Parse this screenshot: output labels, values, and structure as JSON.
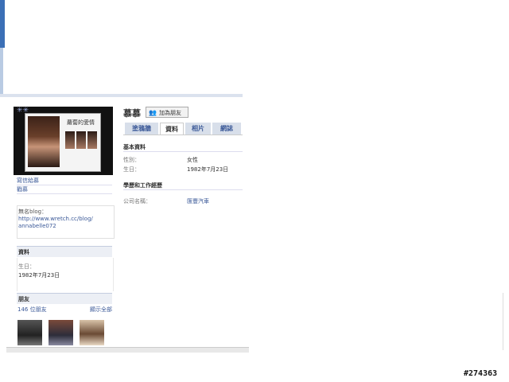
{
  "profile": {
    "name": "慕慕",
    "add_friend_label": "加為朋友",
    "photo_title": "蘿蔔的愛情",
    "links": [
      "寫信給慕",
      "戳慕"
    ],
    "blog": {
      "label": "無名blog：",
      "url_line1": "http://www.wretch.cc/blog/",
      "url_line2": "annabelle072"
    },
    "info_box": {
      "heading": "資料",
      "birthday_label": "生日：",
      "birthday_value": "1982年7月23日"
    },
    "friends": {
      "heading": "朋友",
      "count_label": "146 位朋友",
      "show_all_label": "顯示全部"
    }
  },
  "tabs": [
    {
      "label": "塗鴉牆",
      "active": false
    },
    {
      "label": "資料",
      "active": true
    },
    {
      "label": "相片",
      "active": false
    },
    {
      "label": "網誌",
      "active": false
    }
  ],
  "basic_info": {
    "heading": "基本資料",
    "rows": [
      {
        "label": "性別：",
        "value": "女性"
      },
      {
        "label": "生日：",
        "value": "1982年7月23日"
      }
    ]
  },
  "work_info": {
    "heading": "學歷和工作經歷",
    "rows": [
      {
        "label": "公司名稱：",
        "value": "匯豐汽車"
      }
    ]
  },
  "watermark": "#274363",
  "colors": {
    "link": "#3b5998",
    "tab_bg": "#d8dfea",
    "header_rule": "#dbe2ee"
  }
}
